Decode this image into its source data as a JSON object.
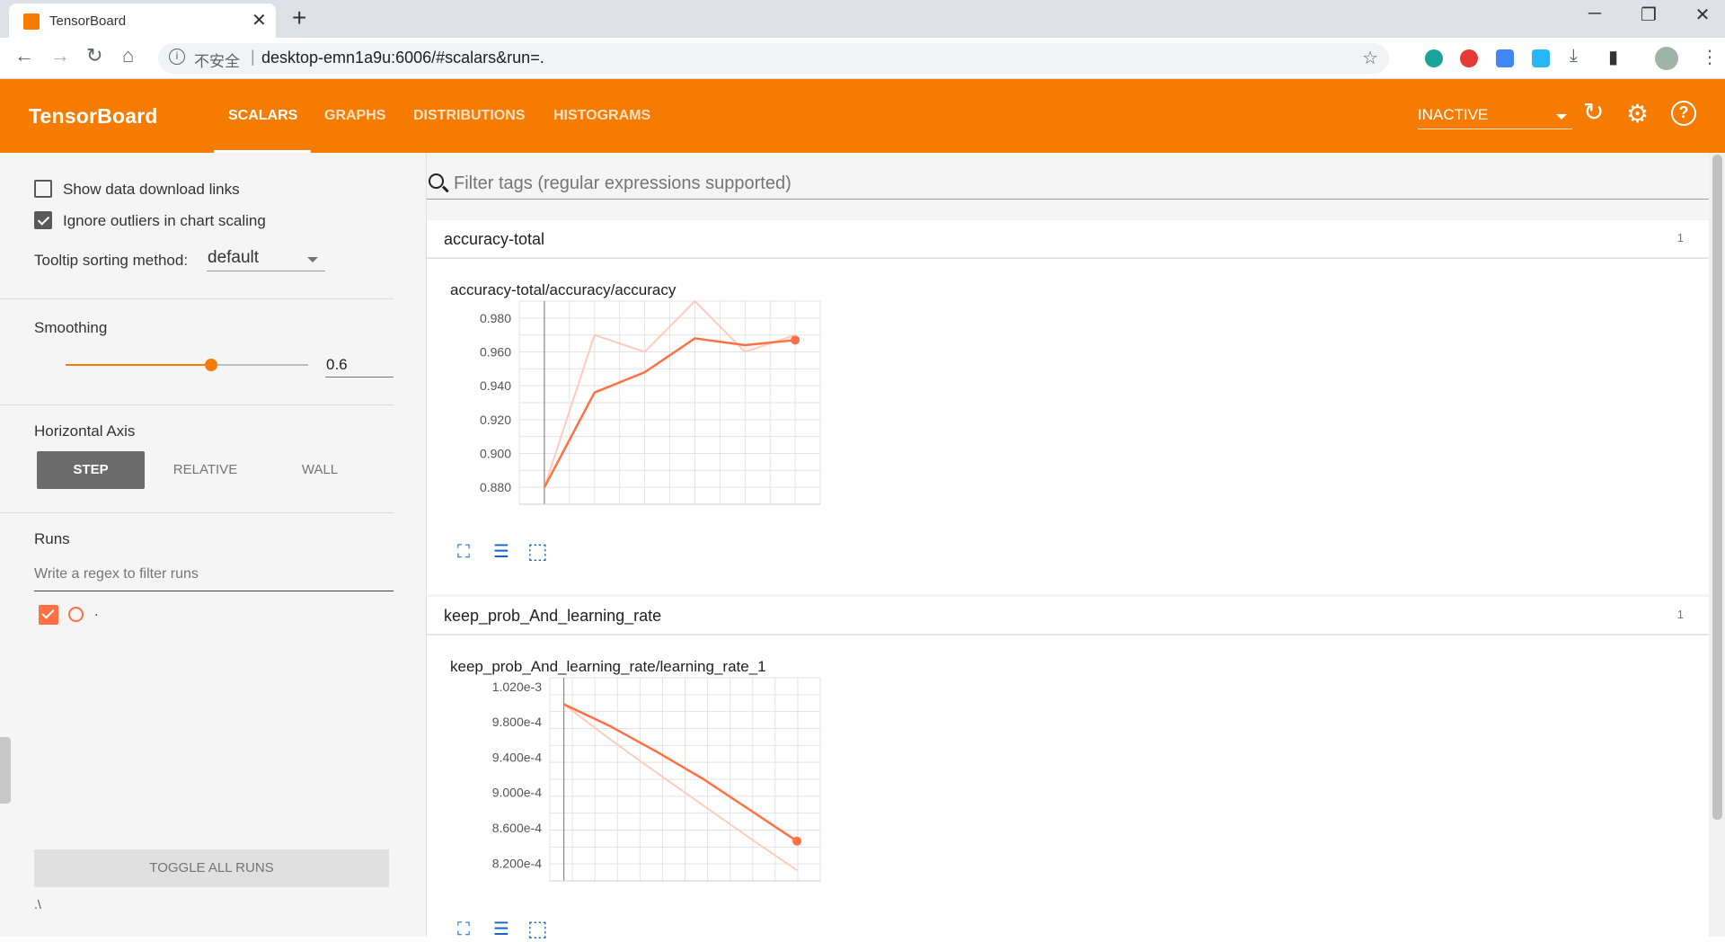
{
  "browser": {
    "tab_title": "TensorBoard",
    "tab_close": "✕",
    "new_tab": "+",
    "security_label": "不安全",
    "url": "desktop-emn1a9u:6006/#scalars&run=."
  },
  "header": {
    "brand": "TensorBoard",
    "tabs": [
      {
        "label": "SCALARS",
        "active": true
      },
      {
        "label": "GRAPHS",
        "active": false
      },
      {
        "label": "DISTRIBUTIONS",
        "active": false
      },
      {
        "label": "HISTOGRAMS",
        "active": false
      }
    ],
    "run_status": "INACTIVE"
  },
  "sidebar": {
    "show_download_links": {
      "label": "Show data download links",
      "checked": false
    },
    "ignore_outliers": {
      "label": "Ignore outliers in chart scaling",
      "checked": true
    },
    "tooltip_label": "Tooltip sorting method:",
    "tooltip_value": "default",
    "smoothing_label": "Smoothing",
    "smoothing_value": "0.6",
    "smoothing_fraction": 0.6,
    "horizontal_axis_label": "Horizontal Axis",
    "axis_options": [
      "STEP",
      "RELATIVE",
      "WALL"
    ],
    "axis_selected": "STEP",
    "runs_label": "Runs",
    "runs_filter_placeholder": "Write a regex to filter runs",
    "runs": [
      {
        "name": ".",
        "checked": true,
        "color": "#ff7043"
      }
    ],
    "toggle_all": "TOGGLE ALL RUNS",
    "logdir": ".\\"
  },
  "main": {
    "filter_placeholder": "Filter tags (regular expressions supported)",
    "categories": [
      {
        "name": "accuracy-total",
        "count": "1",
        "card_title": "accuracy-total/accuracy/accuracy"
      },
      {
        "name": "keep_prob_And_learning_rate",
        "count": "1",
        "card_title": "keep_prob_And_learning_rate/learning_rate_1"
      }
    ]
  },
  "colors": {
    "accent": "#f57c00",
    "series": "#ff7043",
    "raw_series": "#ffccbc"
  },
  "chart_data": [
    {
      "type": "line",
      "title": "accuracy-total/accuracy/accuracy",
      "x_ticks": [
        "0.000",
        "1.000",
        "2.000",
        "3.000",
        "4.000",
        "5.000"
      ],
      "y_ticks": [
        "0.980",
        "0.960",
        "0.940",
        "0.920",
        "0.900",
        "0.880"
      ],
      "xlim": [
        -0.5,
        5.5
      ],
      "ylim": [
        0.87,
        0.99
      ],
      "x": [
        0,
        1,
        2,
        3,
        4,
        5
      ],
      "series": [
        {
          "values": [
            0.88,
            0.97,
            0.96,
            0.99,
            0.96,
            0.97
          ]
        },
        {
          "values": [
            0.88,
            0.936,
            0.948,
            0.968,
            0.964,
            0.967
          ]
        }
      ]
    },
    {
      "type": "line",
      "title": "keep_prob_And_learning_rate/learning_rate_1",
      "x_ticks": [
        "0.000",
        "1.000",
        "2.000",
        "3.000",
        "4.000",
        "5.000"
      ],
      "y_ticks": [
        "1.020e-3",
        "9.800e-4",
        "9.400e-4",
        "9.000e-4",
        "8.600e-4",
        "8.200e-4"
      ],
      "xlim": [
        -0.3,
        5.5
      ],
      "ylim": [
        0.0008,
        0.00103
      ],
      "x": [
        0,
        1,
        2,
        3,
        4,
        5
      ],
      "series": [
        {
          "values": [
            0.001,
            0.00096,
            0.000922,
            0.000885,
            0.000848,
            0.000812
          ]
        },
        {
          "values": [
            0.001,
            0.000975,
            0.000946,
            0.000915,
            0.00088,
            0.000845
          ]
        }
      ]
    }
  ]
}
